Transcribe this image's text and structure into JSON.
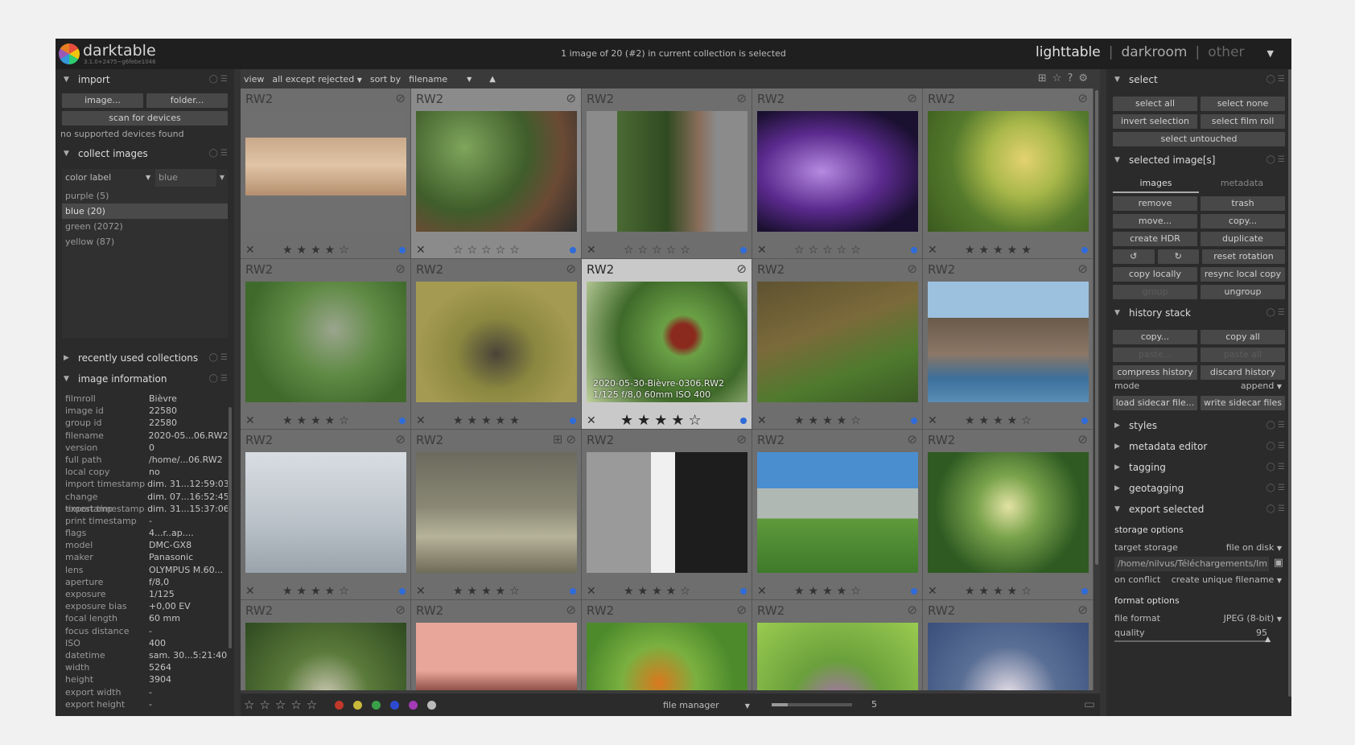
{
  "app": {
    "name": "darktable",
    "version": "3.1.0+2475~g6febe1046"
  },
  "status_text": "1 image of 20 (#2) in current collection is selected",
  "views": {
    "lighttable": "lighttable",
    "darkroom": "darkroom",
    "other": "other",
    "sep": "|",
    "menu": "▼"
  },
  "left": {
    "import": {
      "title": "import",
      "image_btn": "image...",
      "folder_btn": "folder...",
      "scan_btn": "scan for devices",
      "no_devices": "no supported devices found"
    },
    "collect": {
      "title": "collect images",
      "property": "color label",
      "value": "blue",
      "items": [
        {
          "label": "purple (5)"
        },
        {
          "label": "blue (20)"
        },
        {
          "label": "green (2072)"
        },
        {
          "label": "yellow (87)"
        }
      ]
    },
    "recent_title": "recently used collections",
    "info_title": "image information",
    "info": [
      {
        "k": "filmroll",
        "v": "Bièvre"
      },
      {
        "k": "image id",
        "v": "22580"
      },
      {
        "k": "group id",
        "v": "22580"
      },
      {
        "k": "filename",
        "v": "2020-05...06.RW2"
      },
      {
        "k": "version",
        "v": "0"
      },
      {
        "k": "full path",
        "v": "/home/...06.RW2"
      },
      {
        "k": "local copy",
        "v": "no"
      },
      {
        "k": "import timestamp",
        "v": "dim. 31...12:59:03"
      },
      {
        "k": "change timestamp",
        "v": "dim. 07...16:52:45"
      },
      {
        "k": "export timestamp",
        "v": "dim. 31...15:37:06"
      },
      {
        "k": "print timestamp",
        "v": "-"
      },
      {
        "k": "flags",
        "v": "4...r..ap...."
      },
      {
        "k": "model",
        "v": "DMC-GX8"
      },
      {
        "k": "maker",
        "v": "Panasonic"
      },
      {
        "k": "lens",
        "v": "OLYMPUS M.60..."
      },
      {
        "k": "aperture",
        "v": "f/8,0"
      },
      {
        "k": "exposure",
        "v": "1/125"
      },
      {
        "k": "exposure bias",
        "v": "+0,00 EV"
      },
      {
        "k": "focal length",
        "v": "60 mm"
      },
      {
        "k": "focus distance",
        "v": "-"
      },
      {
        "k": "ISO",
        "v": "400"
      },
      {
        "k": "datetime",
        "v": "sam. 30...5:21:40"
      },
      {
        "k": "width",
        "v": "5264"
      },
      {
        "k": "height",
        "v": "3904"
      },
      {
        "k": "export width",
        "v": "-"
      },
      {
        "k": "export height",
        "v": "-"
      }
    ]
  },
  "center": {
    "view_label": "view",
    "view_value": "all except rejected",
    "sort_label": "sort by",
    "sort_value": "filename",
    "sort_dir": "▲",
    "thumbs": [
      {
        "ext": "RW2",
        "label": "blue",
        "stars": "★★★★☆",
        "state": "",
        "image": "raptor-gorge"
      },
      {
        "ext": "RW2",
        "label": "blue",
        "stars": "☆☆☆☆☆",
        "state": "sel",
        "image": "garden-bicycle"
      },
      {
        "ext": "RW2",
        "label": "blue",
        "stars": "☆☆☆☆☆",
        "state": "",
        "image": "garden-gate"
      },
      {
        "ext": "RW2",
        "label": "blue",
        "stars": "☆☆☆☆☆",
        "state": "",
        "image": "purple-flower"
      },
      {
        "ext": "RW2",
        "label": "blue",
        "stars": "★★★★★",
        "state": "",
        "image": "butterfly"
      },
      {
        "ext": "RW2",
        "label": "blue",
        "stars": "★★★★☆",
        "state": "",
        "image": "mountain-chalet"
      },
      {
        "ext": "RW2",
        "label": "blue",
        "stars": "★★★★★",
        "state": "",
        "image": "duck-water"
      },
      {
        "ext": "RW2",
        "label": "blue",
        "stars": "★★★★☆",
        "state": "hover",
        "image": "red-beetle",
        "info1": "2020-05-30-Bièvre-0306.RW2",
        "info2": "1/125 f/8,0 60mm ISO 400"
      },
      {
        "ext": "RW2",
        "label": "blue",
        "stars": "★★★★☆",
        "state": "",
        "image": "lizard-grass"
      },
      {
        "ext": "RW2",
        "label": "blue",
        "stars": "★★★★☆",
        "state": "",
        "image": "coastal-rocks"
      },
      {
        "ext": "RW2",
        "label": "blue",
        "stars": "★★★★☆",
        "state": "",
        "image": "birds-sky"
      },
      {
        "ext": "RW2",
        "label": "blue",
        "stars": "★★★★☆",
        "state": "",
        "image": "dragonfly",
        "extra_icon": "⊞"
      },
      {
        "ext": "RW2",
        "label": "blue",
        "stars": "★★★★☆",
        "state": "",
        "image": "cat-closeup"
      },
      {
        "ext": "RW2",
        "label": "blue",
        "stars": "★★★★☆",
        "state": "",
        "image": "alpine-meadow"
      },
      {
        "ext": "RW2",
        "label": "blue",
        "stars": "★★★★☆",
        "state": "",
        "image": "green-flower"
      },
      {
        "ext": "RW2",
        "label": "blue",
        "stars": "",
        "state": "",
        "image": "tree-rock"
      },
      {
        "ext": "RW2",
        "label": "blue",
        "stars": "",
        "state": "",
        "image": "pink-mountain"
      },
      {
        "ext": "RW2",
        "label": "blue",
        "stars": "",
        "state": "",
        "image": "orange-butterfly"
      },
      {
        "ext": "RW2",
        "label": "blue",
        "stars": "",
        "state": "",
        "image": "thistle"
      },
      {
        "ext": "RW2",
        "label": "blue",
        "stars": "",
        "state": "",
        "image": "white-flowers"
      }
    ],
    "bottom": {
      "stars": "☆☆☆☆☆",
      "labels": [
        "red",
        "yellow",
        "green",
        "blue",
        "purple",
        "grey"
      ],
      "layout": "file manager",
      "zoom_value": "5",
      "zoom_fraction": 0.2
    }
  },
  "right": {
    "select": {
      "title": "select",
      "all": "select all",
      "none": "select none",
      "invert": "invert selection",
      "filmroll": "select film roll",
      "untouched": "select untouched"
    },
    "selected": {
      "title": "selected image[s]",
      "tab_images": "images",
      "tab_metadata": "metadata",
      "remove": "remove",
      "trash": "trash",
      "move": "move...",
      "copy": "copy...",
      "hdr": "create HDR",
      "duplicate": "duplicate",
      "rot_ccw": "↺",
      "rot_cw": "↻",
      "reset_rot": "reset rotation",
      "copy_locally": "copy locally",
      "resync": "resync local copy",
      "group": "group",
      "ungroup": "ungroup"
    },
    "history": {
      "title": "history stack",
      "copy": "copy...",
      "copy_all": "copy all",
      "paste": "paste...",
      "paste_all": "paste all",
      "compress": "compress history",
      "discard": "discard history",
      "mode_label": "mode",
      "mode_value": "append",
      "load_sidecar": "load sidecar file...",
      "write_sidecar": "write sidecar files"
    },
    "modules": [
      {
        "title": "styles"
      },
      {
        "title": "metadata editor"
      },
      {
        "title": "tagging"
      },
      {
        "title": "geotagging"
      }
    ],
    "export": {
      "title": "export selected",
      "storage_options": "storage options",
      "target_label": "target storage",
      "target_value": "file on disk",
      "path": "/home/nilvus/Téléchargements/Im",
      "conflict_label": "on conflict",
      "conflict_value": "create unique filename",
      "format_options": "format options",
      "format_label": "file format",
      "format_value": "JPEG (8-bit)",
      "quality_label": "quality",
      "quality_value": "95"
    }
  },
  "colors": {
    "blue_label": "#2f6bd9",
    "red": "#c0392b",
    "yellow": "#c9b83a",
    "green": "#3aa14a",
    "blue": "#2d4bd1",
    "purple": "#a53ab8",
    "grey": "#bbbbbb"
  }
}
